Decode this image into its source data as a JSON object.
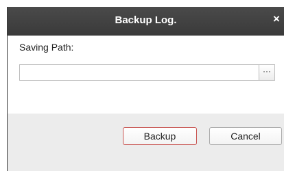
{
  "dialog": {
    "title": "Backup Log.",
    "close_symbol": "×",
    "close_icon": "close-icon"
  },
  "form": {
    "saving_path_label": "Saving Path:",
    "saving_path_value": "",
    "browse_label": "···",
    "browse_icon": "ellipsis-icon"
  },
  "buttons": {
    "backup_label": "Backup",
    "cancel_label": "Cancel"
  },
  "colors": {
    "titlebar": "#3f3f3f",
    "backup_border": "#c8524f"
  }
}
